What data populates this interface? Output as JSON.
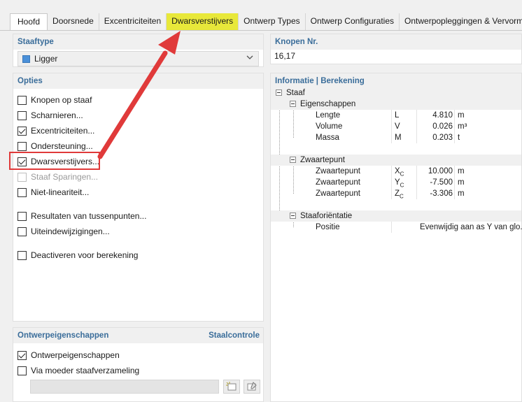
{
  "tabs": [
    {
      "label": "Hoofd",
      "active": true
    },
    {
      "label": "Doorsnede"
    },
    {
      "label": "Excentriciteiten"
    },
    {
      "label": "Dwarsverstijvers",
      "highlight": true
    },
    {
      "label": "Ontwerp Types"
    },
    {
      "label": "Ontwerp Configuraties"
    },
    {
      "label": "Ontwerpopleggingen & Vervormi"
    }
  ],
  "staaftype": {
    "title": "Staaftype",
    "value": "Ligger",
    "color": "#4a90d9"
  },
  "knopen": {
    "title": "Knopen Nr.",
    "value": "16,17"
  },
  "opties": {
    "title": "Opties",
    "items": [
      {
        "label": "Knopen op staaf",
        "checked": false
      },
      {
        "label": "Scharnieren...",
        "checked": false
      },
      {
        "label": "Excentriciteiten...",
        "checked": true
      },
      {
        "label": "Ondersteuning...",
        "checked": false
      },
      {
        "label": "Dwarsverstijvers...",
        "checked": true
      },
      {
        "label": "Staaf Sparingen...",
        "checked": false,
        "disabled": true
      },
      {
        "label": "Niet-lineariteit...",
        "checked": false
      },
      {
        "label": "Resultaten van tussenpunten...",
        "checked": false
      },
      {
        "label": "Uiteindewijzigingen...",
        "checked": false
      },
      {
        "label": "Deactiveren voor berekening",
        "checked": false
      }
    ]
  },
  "info": {
    "title": "Informatie | Berekening",
    "root": "Staaf",
    "eigenschappen": {
      "label": "Eigenschappen",
      "rows": [
        {
          "name": "Lengte",
          "symbol": "L",
          "value": "4.810",
          "unit": "m"
        },
        {
          "name": "Volume",
          "symbol": "V",
          "value": "0.026",
          "unit": "m³"
        },
        {
          "name": "Massa",
          "symbol": "M",
          "value": "0.203",
          "unit": "t"
        }
      ]
    },
    "zwaartepunt": {
      "label": "Zwaartepunt",
      "rows": [
        {
          "name": "Zwaartepunt",
          "symbol": "Xc",
          "value": "10.000",
          "unit": "m"
        },
        {
          "name": "Zwaartepunt",
          "symbol": "Yc",
          "value": "-7.500",
          "unit": "m"
        },
        {
          "name": "Zwaartepunt",
          "symbol": "Zc",
          "value": "-3.306",
          "unit": "m"
        }
      ]
    },
    "orientatie": {
      "label": "Staaforiëntatie",
      "rows": [
        {
          "name": "Positie",
          "value": "Evenwijdig aan as Y van glo..."
        }
      ]
    }
  },
  "ontwerp": {
    "title": "Ontwerpeigenschappen",
    "link": "Staalcontrole",
    "items": [
      {
        "label": "Ontwerpeigenschappen",
        "checked": true
      },
      {
        "label": "Via moeder staafverzameling",
        "checked": false
      }
    ]
  },
  "annotation": {
    "color": "#e03a3a"
  }
}
